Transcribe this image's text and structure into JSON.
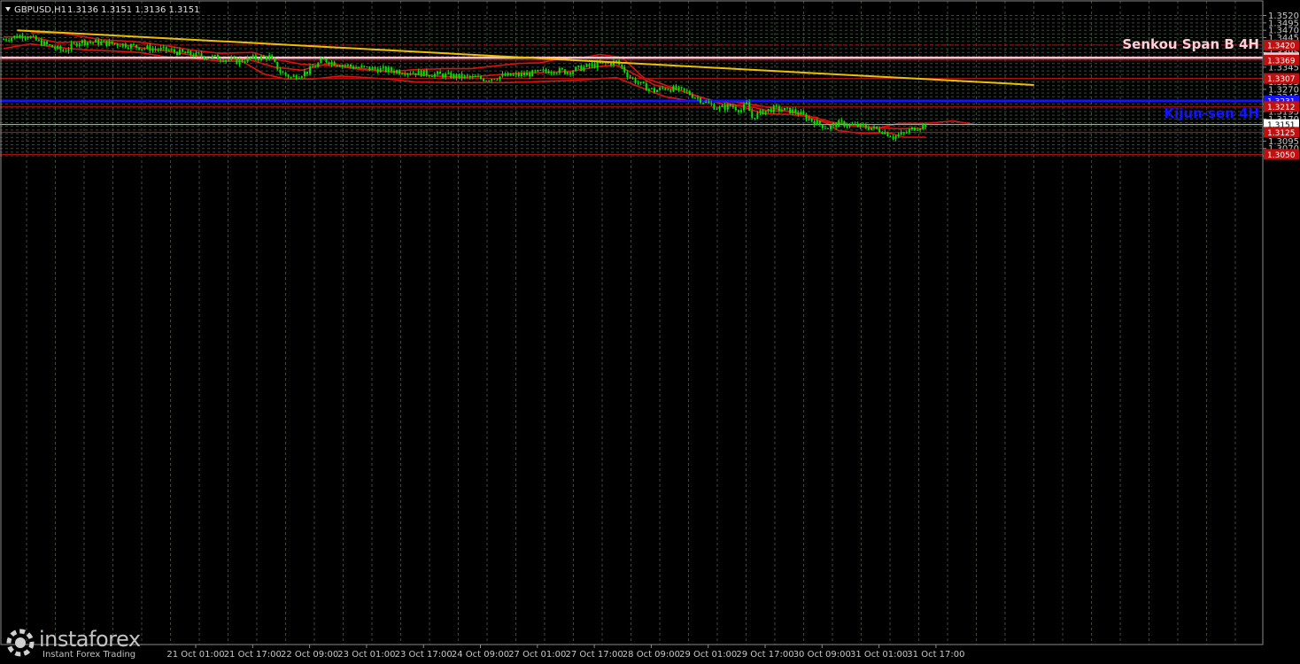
{
  "header": {
    "symbol": "GBPUSD,H1",
    "ohlc": "1.3136 1.3151 1.3136 1.3151"
  },
  "watermark": {
    "brand": "instaforex",
    "tagline": "Instant Forex Trading"
  },
  "colors": {
    "background": "#000000",
    "grid": "#3a4a3a",
    "bull": "#00e600",
    "bear": "#00e600",
    "ichimoku": "#e01010",
    "trendline": "#f0c000",
    "senkou": "#ffc0cb",
    "kijun": "#1414ff",
    "level": "#c01010",
    "price_line": "#c0c0c0"
  },
  "chart_data": {
    "type": "candlestick",
    "title": "GBPUSD,H1",
    "ylim": [
      1.3035,
      1.3535
    ],
    "y_ticks": [
      "1.3520",
      "1.3495",
      "1.3470",
      "1.3445",
      "1.3395",
      "1.3345",
      "1.3295",
      "1.3270",
      "1.3245",
      "1.3220",
      "1.3195",
      "1.3170",
      "1.3145",
      "1.3120",
      "1.3095",
      "1.3070",
      "1.3045"
    ],
    "x_tick_labels": [
      "21 Oct 01:00",
      "21 Oct 17:00",
      "22 Oct 09:00",
      "23 Oct 01:00",
      "23 Oct 17:00",
      "24 Oct 09:00",
      "27 Oct 01:00",
      "27 Oct 17:00",
      "28 Oct 09:00",
      "29 Oct 01:00",
      "29 Oct 17:00",
      "30 Oct 09:00",
      "31 Oct 01:00",
      "31 Oct 17:00"
    ],
    "close_path": [
      [
        0,
        1.344
      ],
      [
        8,
        1.3455
      ],
      [
        12,
        1.3435
      ],
      [
        16,
        1.342
      ],
      [
        22,
        1.34
      ],
      [
        28,
        1.3432
      ],
      [
        36,
        1.3428
      ],
      [
        44,
        1.3422
      ],
      [
        52,
        1.341
      ],
      [
        60,
        1.3403
      ],
      [
        68,
        1.339
      ],
      [
        74,
        1.3382
      ],
      [
        80,
        1.3376
      ],
      [
        86,
        1.3365
      ],
      [
        92,
        1.3375
      ],
      [
        98,
        1.338
      ],
      [
        102,
        1.333
      ],
      [
        106,
        1.331
      ],
      [
        112,
        1.333
      ],
      [
        118,
        1.337
      ],
      [
        124,
        1.3355
      ],
      [
        130,
        1.3345
      ],
      [
        136,
        1.334
      ],
      [
        142,
        1.3335
      ],
      [
        148,
        1.333
      ],
      [
        154,
        1.3325
      ],
      [
        160,
        1.332
      ],
      [
        166,
        1.3315
      ],
      [
        172,
        1.331
      ],
      [
        178,
        1.3305
      ],
      [
        184,
        1.3315
      ],
      [
        190,
        1.3318
      ],
      [
        196,
        1.3325
      ],
      [
        202,
        1.3335
      ],
      [
        208,
        1.333
      ],
      [
        214,
        1.3345
      ],
      [
        220,
        1.3355
      ],
      [
        224,
        1.336
      ],
      [
        226,
        1.3363
      ],
      [
        228,
        1.3345
      ],
      [
        230,
        1.332
      ],
      [
        232,
        1.3305
      ],
      [
        236,
        1.328
      ],
      [
        240,
        1.3265
      ],
      [
        244,
        1.3275
      ],
      [
        248,
        1.327
      ],
      [
        252,
        1.326
      ],
      [
        256,
        1.324
      ],
      [
        260,
        1.322
      ],
      [
        264,
        1.3205
      ],
      [
        268,
        1.3215
      ],
      [
        272,
        1.32
      ],
      [
        274,
        1.322
      ],
      [
        276,
        1.3175
      ],
      [
        280,
        1.3195
      ],
      [
        284,
        1.3205
      ],
      [
        288,
        1.32
      ],
      [
        292,
        1.3195
      ],
      [
        296,
        1.3175
      ],
      [
        300,
        1.3155
      ],
      [
        304,
        1.314
      ],
      [
        308,
        1.3155
      ],
      [
        312,
        1.315
      ],
      [
        316,
        1.3145
      ],
      [
        320,
        1.314
      ],
      [
        324,
        1.313
      ],
      [
        328,
        1.311
      ],
      [
        332,
        1.312
      ],
      [
        336,
        1.314
      ],
      [
        340,
        1.3151
      ]
    ],
    "tenkan_path": [
      [
        0,
        1.3448
      ],
      [
        10,
        1.3448
      ],
      [
        20,
        1.3428
      ],
      [
        30,
        1.3432
      ],
      [
        40,
        1.3428
      ],
      [
        50,
        1.3412
      ],
      [
        60,
        1.34
      ],
      [
        70,
        1.3385
      ],
      [
        80,
        1.3376
      ],
      [
        90,
        1.3372
      ],
      [
        100,
        1.3345
      ],
      [
        110,
        1.3335
      ],
      [
        120,
        1.3358
      ],
      [
        130,
        1.3343
      ],
      [
        140,
        1.3332
      ],
      [
        150,
        1.3322
      ],
      [
        160,
        1.3315
      ],
      [
        170,
        1.331
      ],
      [
        180,
        1.3318
      ],
      [
        190,
        1.3325
      ],
      [
        200,
        1.3327
      ],
      [
        210,
        1.3332
      ],
      [
        220,
        1.3348
      ],
      [
        226,
        1.3352
      ],
      [
        232,
        1.3325
      ],
      [
        240,
        1.3285
      ],
      [
        250,
        1.3265
      ],
      [
        260,
        1.3235
      ],
      [
        266,
        1.3218
      ],
      [
        272,
        1.3215
      ],
      [
        276,
        1.321
      ],
      [
        282,
        1.3198
      ],
      [
        290,
        1.3196
      ],
      [
        298,
        1.3177
      ],
      [
        306,
        1.3158
      ],
      [
        314,
        1.315
      ],
      [
        322,
        1.314
      ],
      [
        330,
        1.3137
      ],
      [
        336,
        1.3138
      ],
      [
        340,
        1.3138
      ]
    ],
    "kijun_path": [
      [
        0,
        1.3408
      ],
      [
        10,
        1.3424
      ],
      [
        20,
        1.3412
      ],
      [
        30,
        1.3404
      ],
      [
        40,
        1.34
      ],
      [
        50,
        1.3395
      ],
      [
        60,
        1.338
      ],
      [
        70,
        1.3375
      ],
      [
        80,
        1.3365
      ],
      [
        88,
        1.3365
      ],
      [
        96,
        1.3322
      ],
      [
        104,
        1.3305
      ],
      [
        114,
        1.3305
      ],
      [
        124,
        1.3315
      ],
      [
        134,
        1.331
      ],
      [
        144,
        1.3303
      ],
      [
        152,
        1.3295
      ],
      [
        164,
        1.3293
      ],
      [
        176,
        1.3293
      ],
      [
        186,
        1.3293
      ],
      [
        196,
        1.3296
      ],
      [
        208,
        1.33
      ],
      [
        218,
        1.3305
      ],
      [
        226,
        1.331
      ],
      [
        234,
        1.328
      ],
      [
        244,
        1.3245
      ],
      [
        254,
        1.323
      ],
      [
        264,
        1.323
      ],
      [
        272,
        1.3213
      ],
      [
        280,
        1.3188
      ],
      [
        290,
        1.3185
      ],
      [
        300,
        1.3175
      ],
      [
        308,
        1.313
      ],
      [
        318,
        1.312
      ],
      [
        326,
        1.3125
      ],
      [
        332,
        1.3108
      ],
      [
        340,
        1.3108
      ]
    ],
    "senkou_a_path": [
      [
        10,
        1.3462
      ],
      [
        22,
        1.346
      ],
      [
        36,
        1.3438
      ],
      [
        48,
        1.3432
      ],
      [
        60,
        1.3418
      ],
      [
        70,
        1.3402
      ],
      [
        80,
        1.3392
      ],
      [
        92,
        1.3395
      ],
      [
        100,
        1.3372
      ],
      [
        110,
        1.3355
      ],
      [
        122,
        1.335
      ],
      [
        132,
        1.3337
      ],
      [
        142,
        1.333
      ],
      [
        152,
        1.3337
      ],
      [
        162,
        1.334
      ],
      [
        172,
        1.334
      ],
      [
        182,
        1.335
      ],
      [
        190,
        1.3358
      ],
      [
        198,
        1.336
      ],
      [
        206,
        1.3375
      ],
      [
        214,
        1.3378
      ],
      [
        220,
        1.3388
      ],
      [
        228,
        1.3378
      ],
      [
        236,
        1.331
      ],
      [
        246,
        1.3278
      ],
      [
        256,
        1.3245
      ],
      [
        262,
        1.3232
      ],
      [
        270,
        1.3227
      ],
      [
        282,
        1.321
      ],
      [
        292,
        1.319
      ],
      [
        302,
        1.316
      ],
      [
        314,
        1.3145
      ],
      [
        322,
        1.3138
      ],
      [
        330,
        1.3155
      ],
      [
        340,
        1.3155
      ],
      [
        350,
        1.3163
      ],
      [
        358,
        1.3152
      ]
    ],
    "levels": [
      {
        "price": 1.342,
        "label": "1.3420",
        "style": "dash",
        "color": "#c01010"
      },
      {
        "price": 1.3377,
        "label": "1.3377",
        "style": "solid",
        "color": "#ffc0cb",
        "name": "Senkou Span B 4H"
      },
      {
        "price": 1.3369,
        "label": "1.3369",
        "style": "solid",
        "color": "#c01010"
      },
      {
        "price": 1.3307,
        "label": "1.3307",
        "style": "solid",
        "color": "#c01010"
      },
      {
        "price": 1.3231,
        "label": "1.3231",
        "style": "solid",
        "color": "#1414ff",
        "name": "Kijun-sen 4H"
      },
      {
        "price": 1.3212,
        "label": "1.3212",
        "style": "solid",
        "color": "#c01010"
      },
      {
        "price": 1.3151,
        "label": "1.3151",
        "style": "solid",
        "color": "#c0c0c0"
      },
      {
        "price": 1.3125,
        "label": "1.3125",
        "style": "solid",
        "color": "#c01010"
      },
      {
        "price": 1.305,
        "label": "1.3050",
        "style": "solid",
        "color": "#c01010"
      }
    ],
    "trendline": {
      "from": [
        5,
        1.347
      ],
      "to": [
        380,
        1.3285
      ]
    },
    "n_bars": 341
  }
}
